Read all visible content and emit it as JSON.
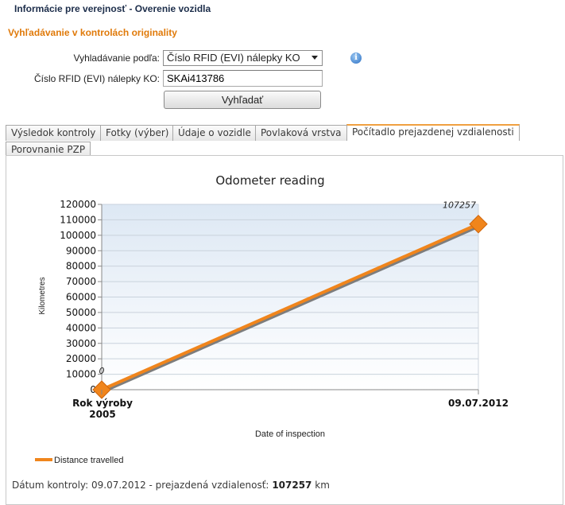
{
  "header": {
    "page_title": "Informácie pre verejnosť - Overenie vozidla",
    "section_title": "Vyhľadávanie v kontrolách originality"
  },
  "search_form": {
    "search_by_label": "Vyhladávanie podľa:",
    "search_by_value": "Číslo RFID (EVI) nálepky KO",
    "rfid_label": "Číslo RFID (EVI) nálepky KO:",
    "rfid_value": "SKAi413786",
    "search_button": "Vyhľadať",
    "info_icon": "info-icon"
  },
  "tabs": [
    {
      "label": "Výsledok kontroly",
      "active": false
    },
    {
      "label": "Fotky (výber)",
      "active": false
    },
    {
      "label": "Údaje o vozidle",
      "active": false
    },
    {
      "label": "Povlaková vrstva",
      "active": false
    },
    {
      "label": "Počítadlo prejazdenej vzdialenosti",
      "active": true
    },
    {
      "label": "Porovnanie PZP",
      "active": false
    }
  ],
  "chart_data": {
    "type": "line",
    "title": "Odometer reading",
    "xlabel": "Date of inspection",
    "ylabel": "Kilometres",
    "categories": [
      "Rok výroby 2005",
      "09.07.2012"
    ],
    "category_lines": [
      [
        "Rok výroby",
        "2005"
      ],
      [
        "09.07.2012"
      ]
    ],
    "series": [
      {
        "name": "Distance travelled",
        "values": [
          0,
          107257
        ],
        "color": "#f0851c"
      }
    ],
    "data_labels": [
      "0",
      "107257"
    ],
    "ylim": [
      0,
      120000
    ],
    "yticks": [
      0,
      10000,
      20000,
      30000,
      40000,
      50000,
      60000,
      70000,
      80000,
      90000,
      100000,
      110000,
      120000
    ],
    "grid": true,
    "legend_position": "bottom-left"
  },
  "status": {
    "prefix": "Dátum kontroly: 09.07.2012 - prejazdená vzdialenosť:",
    "value": "107257",
    "unit": "km"
  }
}
